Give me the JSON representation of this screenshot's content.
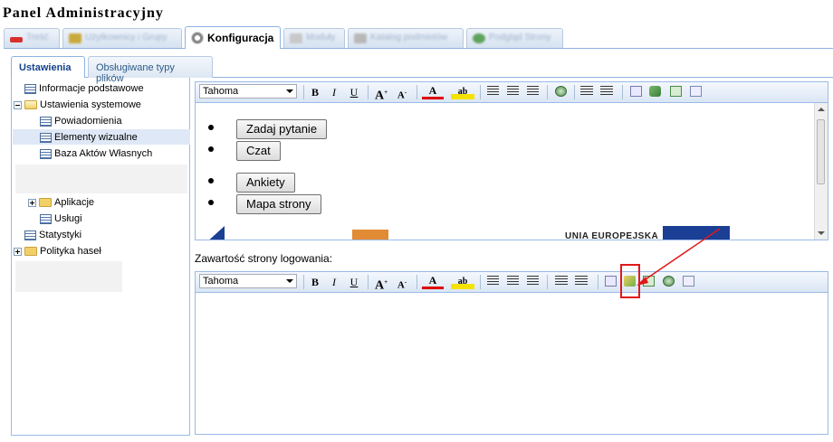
{
  "app": {
    "title": "Panel Administracyjny"
  },
  "top_tabs": [
    {
      "label": "Treść",
      "icon": "red-bar-icon",
      "color": "#d9302b",
      "active": false
    },
    {
      "label": "Użytkownicy i Grupy",
      "icon": "users-icon",
      "color": "#c9a93c",
      "active": false
    },
    {
      "label": "Konfiguracja",
      "icon": "gear-icon",
      "color": "#8a8a8a",
      "active": true
    },
    {
      "label": "Moduły",
      "icon": "module-icon",
      "color": "#c8c8c8",
      "active": false
    },
    {
      "label": "Katalog podmiotów",
      "icon": "catalog-icon",
      "color": "#b8b8b8",
      "active": false
    },
    {
      "label": "Podgląd Strony",
      "icon": "globe-icon",
      "color": "#5fa35c",
      "active": false
    }
  ],
  "sub_tabs": [
    {
      "label": "Ustawienia",
      "active": true
    },
    {
      "label": "Obsługiwane typy plików",
      "active": false
    }
  ],
  "tree": {
    "items": [
      {
        "label": "Informacje podstawowe"
      },
      {
        "label": "Ustawienia systemowe"
      },
      {
        "label": "Powiadomienia"
      },
      {
        "label": "Elementy wizualne"
      },
      {
        "label": "Baza Aktów Własnych"
      },
      {
        "label": "Aplikacje"
      },
      {
        "label": "Usługi"
      },
      {
        "label": "Statystyki"
      },
      {
        "label": "Polityka haseł"
      }
    ]
  },
  "editor1": {
    "font": "Tahoma",
    "buttons": [
      "Zadaj pytanie",
      "Czat",
      "Ankiety",
      "Mapa strony"
    ],
    "footer_logo_text": "UNIA EUROPEJSKA"
  },
  "editor2": {
    "label": "Zawartość strony logowania:",
    "font": "Tahoma"
  },
  "colors": {
    "accent": "#15428b",
    "border": "#99bbe8",
    "highlight": "#e0191b",
    "selection": "#dfe8f6"
  }
}
